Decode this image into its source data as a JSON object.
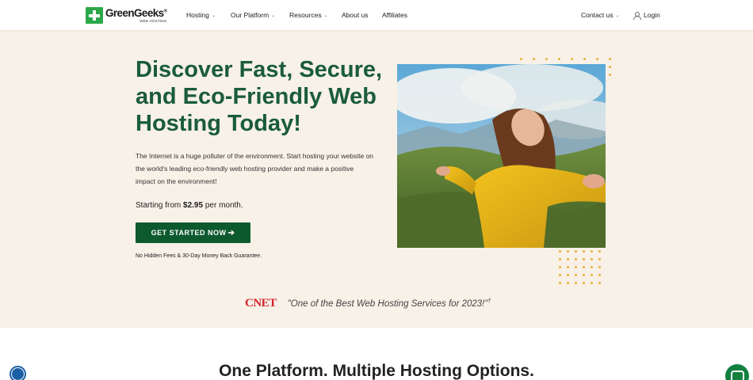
{
  "brand": {
    "name": "GreenGeeks",
    "registered": "®",
    "subtitle": "WEB HOSTING"
  },
  "nav": {
    "items": [
      {
        "label": "Hosting",
        "has_dropdown": true
      },
      {
        "label": "Our Platform",
        "has_dropdown": true
      },
      {
        "label": "Resources",
        "has_dropdown": true
      },
      {
        "label": "About us",
        "has_dropdown": false
      },
      {
        "label": "Affiliates",
        "has_dropdown": false
      }
    ],
    "contact": "Contact us",
    "login": "Login"
  },
  "hero": {
    "title": "Discover Fast, Secure, and Eco-Friendly Web Hosting Today!",
    "description": "The Internet is a huge polluter of the environment. Start hosting your website on the world's leading eco-friendly web hosting provider and make a positive impact on the environment!",
    "price_prefix": "Starting from",
    "price": "$2.95",
    "price_suffix": "per month.",
    "cta_label": "GET STARTED NOW",
    "cta_arrow": "➔",
    "guarantee": "No Hidden Fees & 30-Day Money Back Guarantee."
  },
  "press": {
    "logo": "CNET",
    "quote": "\"One of the Best Web Hosting Services for 2023!\"",
    "mark": "†"
  },
  "section": {
    "title": "One Platform. Multiple Hosting Options."
  },
  "colors": {
    "brand_green": "#2ba84a",
    "cta_green": "#0e5a2f",
    "heading_green": "#1a5c3a",
    "hero_bg": "#f7f1e8",
    "accent_gold": "#e9b23a",
    "cnet_red": "#d5232a"
  },
  "icons": {
    "logo": "plus-logo-icon",
    "dropdown": "chevron-down-icon",
    "login": "user-icon",
    "accessibility": "accessibility-icon",
    "chat": "chat-icon"
  }
}
